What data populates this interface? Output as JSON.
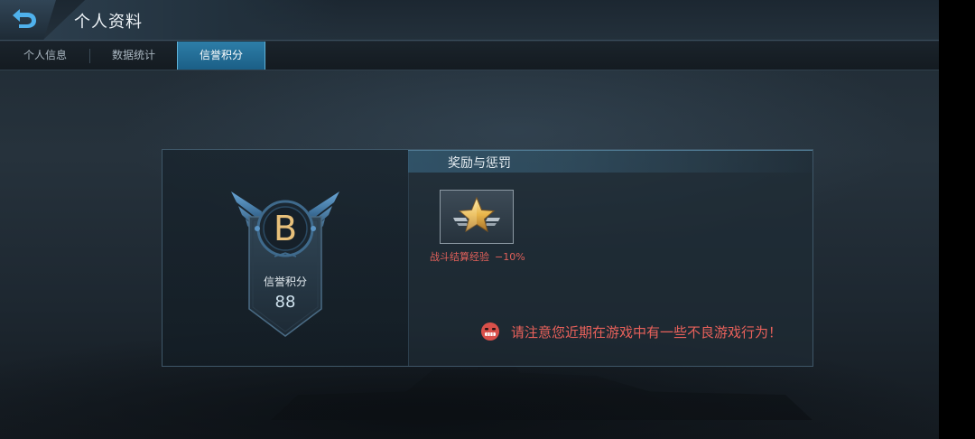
{
  "header": {
    "back_icon": "back-arrow-icon",
    "title": "个人资料"
  },
  "tabs": [
    {
      "label": "个人信息",
      "active": false
    },
    {
      "label": "数据统计",
      "active": false
    },
    {
      "label": "信誉积分",
      "active": true
    }
  ],
  "credit": {
    "grade": "B",
    "label": "信誉积分",
    "score": "88",
    "badge_icon": "winged-shield-badge-icon"
  },
  "rewards": {
    "section_title": "奖励与惩罚",
    "items": [
      {
        "icon": "gold-star-icon",
        "name": "战斗结算经验",
        "value": "−10%"
      }
    ]
  },
  "warning": {
    "icon": "angry-face-icon",
    "text": "请注意您近期在游戏中有一些不良游戏行为！"
  },
  "colors": {
    "accent": "#2d7ea8",
    "grade": "#e8c07a",
    "warning": "#e8615b",
    "badge": "#4e86b5"
  }
}
